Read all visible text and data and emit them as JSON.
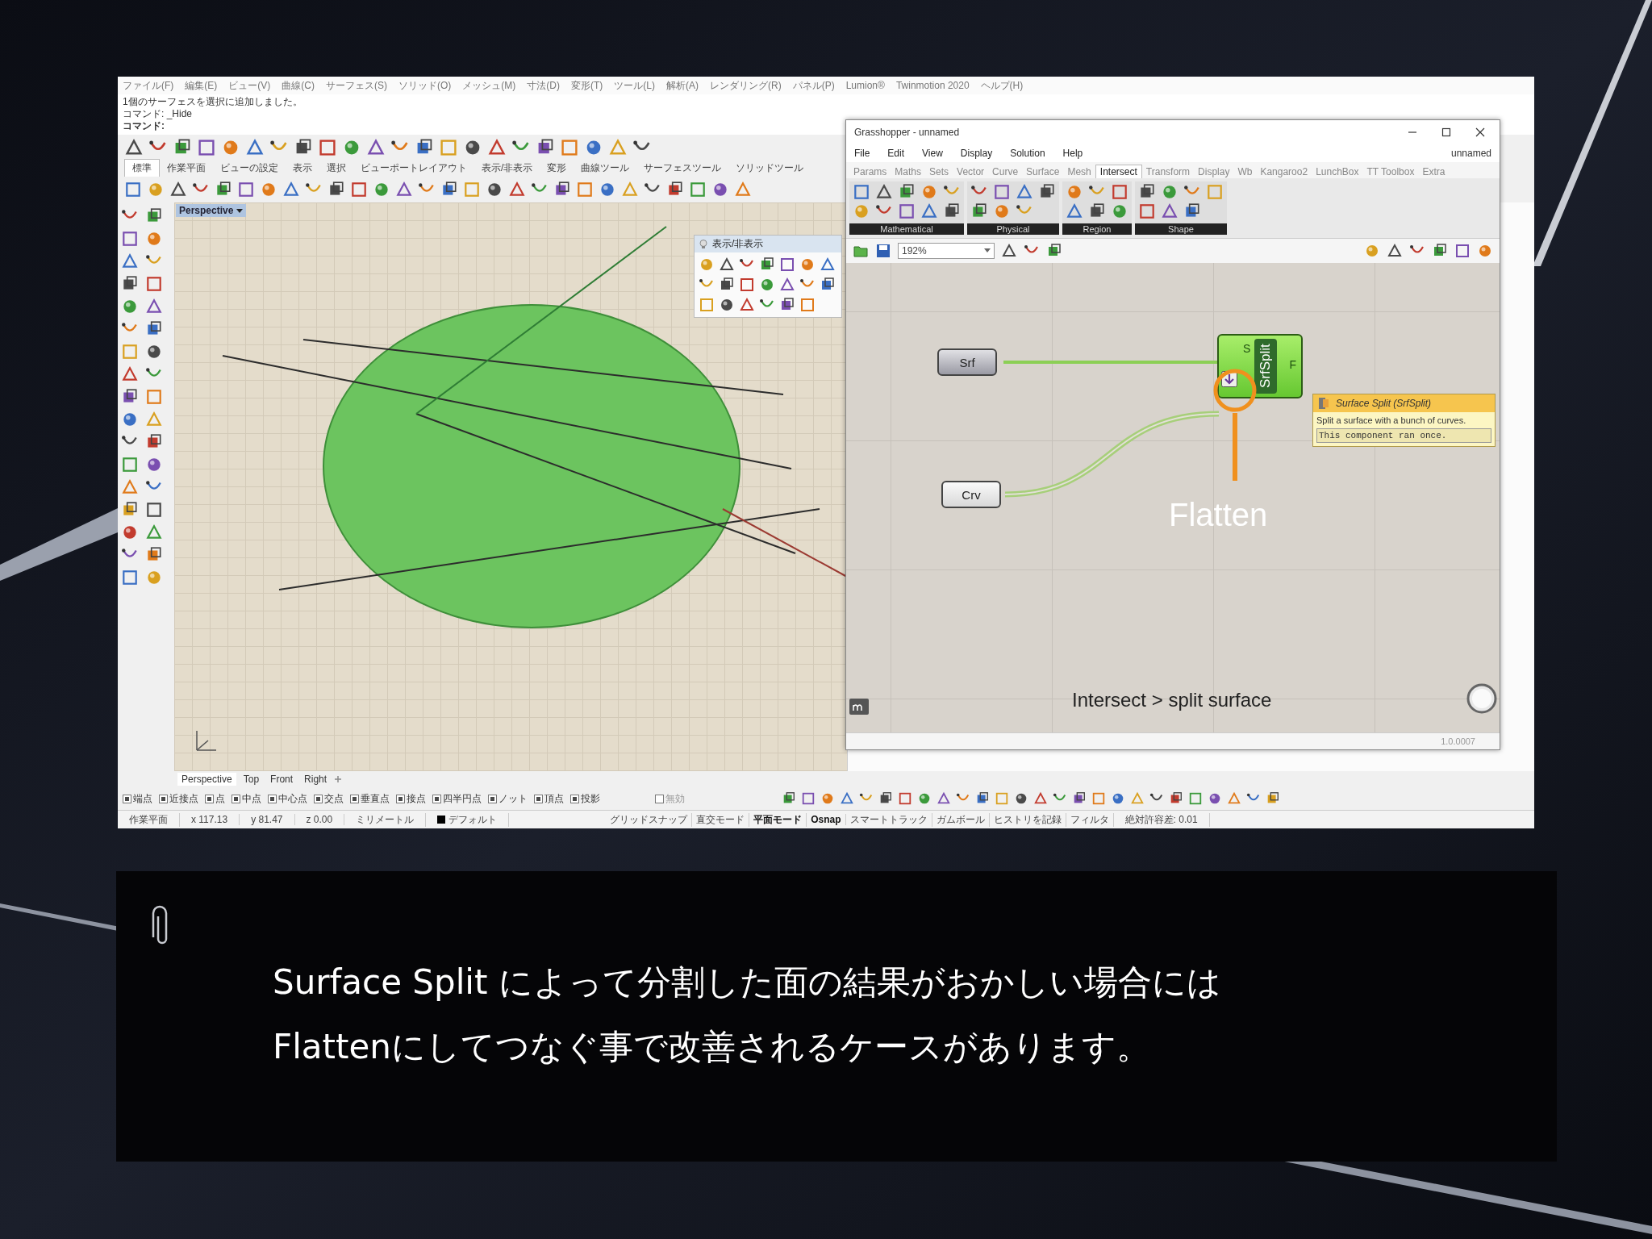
{
  "rhino": {
    "menu": [
      "ファイル(F)",
      "編集(E)",
      "ビュー(V)",
      "曲線(C)",
      "サーフェス(S)",
      "ソリッド(O)",
      "メッシュ(M)",
      "寸法(D)",
      "変形(T)",
      "ツール(L)",
      "解析(A)",
      "レンダリング(R)",
      "パネル(P)",
      "Lumion®",
      "Twinmotion 2020",
      "ヘルプ(H)"
    ],
    "command_history": [
      "1個のサーフェスを選択に追加しました。",
      "コマンド: _Hide"
    ],
    "command_prompt": "コマンド:",
    "toolbar_tabs": [
      {
        "label": "標準",
        "selected": true
      },
      {
        "label": "作業平面",
        "selected": false
      },
      {
        "label": "ビューの設定",
        "selected": false
      },
      {
        "label": "表示",
        "selected": false
      },
      {
        "label": "選択",
        "selected": false
      },
      {
        "label": "ビューポートレイアウト",
        "selected": false
      },
      {
        "label": "表示/非表示",
        "selected": false
      },
      {
        "label": "変形",
        "selected": false
      },
      {
        "label": "曲線ツール",
        "selected": false
      },
      {
        "label": "サーフェスツール",
        "selected": false
      },
      {
        "label": "ソリッドツール",
        "selected": false
      }
    ],
    "viewport_label": "Perspective",
    "float_panel": {
      "title": "表示/非表示"
    },
    "view_tabs": [
      {
        "label": "Perspective",
        "selected": true
      },
      {
        "label": "Top",
        "selected": false
      },
      {
        "label": "Front",
        "selected": false
      },
      {
        "label": "Right",
        "selected": false
      }
    ],
    "osnaps": [
      {
        "label": "端点",
        "checked": true
      },
      {
        "label": "近接点",
        "checked": true
      },
      {
        "label": "点",
        "checked": true
      },
      {
        "label": "中点",
        "checked": true
      },
      {
        "label": "中心点",
        "checked": true
      },
      {
        "label": "交点",
        "checked": true
      },
      {
        "label": "垂直点",
        "checked": true
      },
      {
        "label": "接点",
        "checked": true
      },
      {
        "label": "四半円点",
        "checked": true
      },
      {
        "label": "ノット",
        "checked": true
      },
      {
        "label": "頂点",
        "checked": true
      },
      {
        "label": "投影",
        "checked": true
      },
      {
        "label": "無効",
        "checked": false
      }
    ],
    "status_fields": [
      "作業平面",
      "x 117.13",
      "y 81.47",
      "z 0.00",
      "ミリメートル",
      "デフォルト"
    ],
    "status_toggles": [
      {
        "label": "グリッドスナップ",
        "on": false
      },
      {
        "label": "直交モード",
        "on": false
      },
      {
        "label": "平面モード",
        "on": true
      },
      {
        "label": "Osnap",
        "on": true
      },
      {
        "label": "スマートトラック",
        "on": false
      },
      {
        "label": "ガムボール",
        "on": false
      },
      {
        "label": "ヒストリを記録",
        "on": false
      },
      {
        "label": "フィルタ",
        "on": false
      }
    ],
    "tolerance": "絶対許容差: 0.01"
  },
  "grasshopper": {
    "title": "Grasshopper - unnamed",
    "menu": [
      "File",
      "Edit",
      "View",
      "Display",
      "Solution",
      "Help"
    ],
    "document": "unnamed",
    "tabs": [
      {
        "label": "Params",
        "selected": false
      },
      {
        "label": "Maths",
        "selected": false
      },
      {
        "label": "Sets",
        "selected": false
      },
      {
        "label": "Vector",
        "selected": false
      },
      {
        "label": "Curve",
        "selected": false
      },
      {
        "label": "Surface",
        "selected": false
      },
      {
        "label": "Mesh",
        "selected": false
      },
      {
        "label": "Intersect",
        "selected": true
      },
      {
        "label": "Transform",
        "selected": false
      },
      {
        "label": "Display",
        "selected": false
      },
      {
        "label": "Wb",
        "selected": false
      },
      {
        "label": "Kangaroo2",
        "selected": false
      },
      {
        "label": "LunchBox",
        "selected": false
      },
      {
        "label": "TT Toolbox",
        "selected": false
      },
      {
        "label": "Extra",
        "selected": false
      }
    ],
    "panel_groups": [
      "Mathematical",
      "Physical",
      "Region",
      "Shape"
    ],
    "zoom": "192%",
    "params": [
      "Srf",
      "Crv"
    ],
    "component": {
      "label": "SrfSplit",
      "input": "S",
      "output": "F"
    },
    "tooltip": {
      "title": "Surface Split (SrfSplit)",
      "description": "Split a surface with a bunch of curves.",
      "note": "This component ran once."
    },
    "annotation": "Flatten",
    "caption": "Intersect > split surface",
    "version": "1.0.0007"
  },
  "slide_caption": [
    "Surface Split によって分割した面の結果がおかしい場合には",
    "Flattenにしてつなぐ事で改善されるケースがあります。"
  ]
}
